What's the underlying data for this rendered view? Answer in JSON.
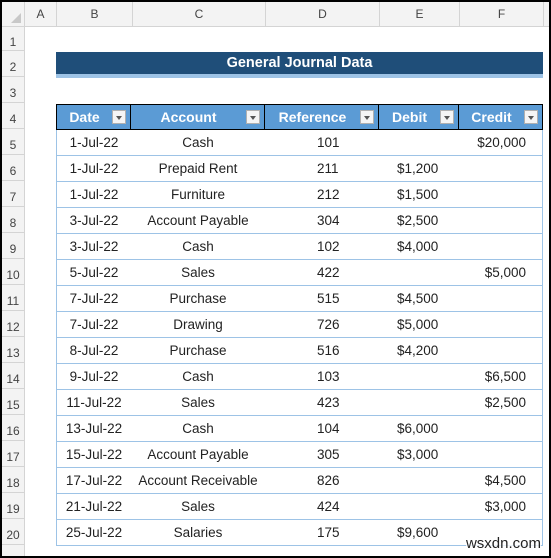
{
  "column_headers": [
    "A",
    "B",
    "C",
    "D",
    "E",
    "F"
  ],
  "row_headers": [
    "1",
    "2",
    "3",
    "4",
    "5",
    "6",
    "7",
    "8",
    "9",
    "10",
    "11",
    "12",
    "13",
    "14",
    "15",
    "16",
    "17",
    "18",
    "19",
    "20"
  ],
  "title": "General Journal Data",
  "table": {
    "headers": [
      "Date",
      "Account",
      "Reference",
      "Debit",
      "Credit"
    ],
    "rows": [
      {
        "date": "1-Jul-22",
        "account": "Cash",
        "reference": "101",
        "debit": "",
        "credit": "$20,000"
      },
      {
        "date": "1-Jul-22",
        "account": "Prepaid Rent",
        "reference": "211",
        "debit": "$1,200",
        "credit": ""
      },
      {
        "date": "1-Jul-22",
        "account": "Furniture",
        "reference": "212",
        "debit": "$1,500",
        "credit": ""
      },
      {
        "date": "3-Jul-22",
        "account": "Account Payable",
        "reference": "304",
        "debit": "$2,500",
        "credit": ""
      },
      {
        "date": "3-Jul-22",
        "account": "Cash",
        "reference": "102",
        "debit": "$4,000",
        "credit": ""
      },
      {
        "date": "5-Jul-22",
        "account": "Sales",
        "reference": "422",
        "debit": "",
        "credit": "$5,000"
      },
      {
        "date": "7-Jul-22",
        "account": "Purchase",
        "reference": "515",
        "debit": "$4,500",
        "credit": ""
      },
      {
        "date": "7-Jul-22",
        "account": "Drawing",
        "reference": "726",
        "debit": "$5,000",
        "credit": ""
      },
      {
        "date": "8-Jul-22",
        "account": "Purchase",
        "reference": "516",
        "debit": "$4,200",
        "credit": ""
      },
      {
        "date": "9-Jul-22",
        "account": "Cash",
        "reference": "103",
        "debit": "",
        "credit": "$6,500"
      },
      {
        "date": "11-Jul-22",
        "account": "Sales",
        "reference": "423",
        "debit": "",
        "credit": "$2,500"
      },
      {
        "date": "13-Jul-22",
        "account": "Cash",
        "reference": "104",
        "debit": "$6,000",
        "credit": ""
      },
      {
        "date": "15-Jul-22",
        "account": "Account Payable",
        "reference": "305",
        "debit": "$3,000",
        "credit": ""
      },
      {
        "date": "17-Jul-22",
        "account": "Account Receivable",
        "reference": "826",
        "debit": "",
        "credit": "$4,500"
      },
      {
        "date": "21-Jul-22",
        "account": "Sales",
        "reference": "424",
        "debit": "",
        "credit": "$3,000"
      },
      {
        "date": "25-Jul-22",
        "account": "Salaries",
        "reference": "175",
        "debit": "$9,600",
        "credit": ""
      }
    ]
  },
  "watermark": "wsxdn.com"
}
